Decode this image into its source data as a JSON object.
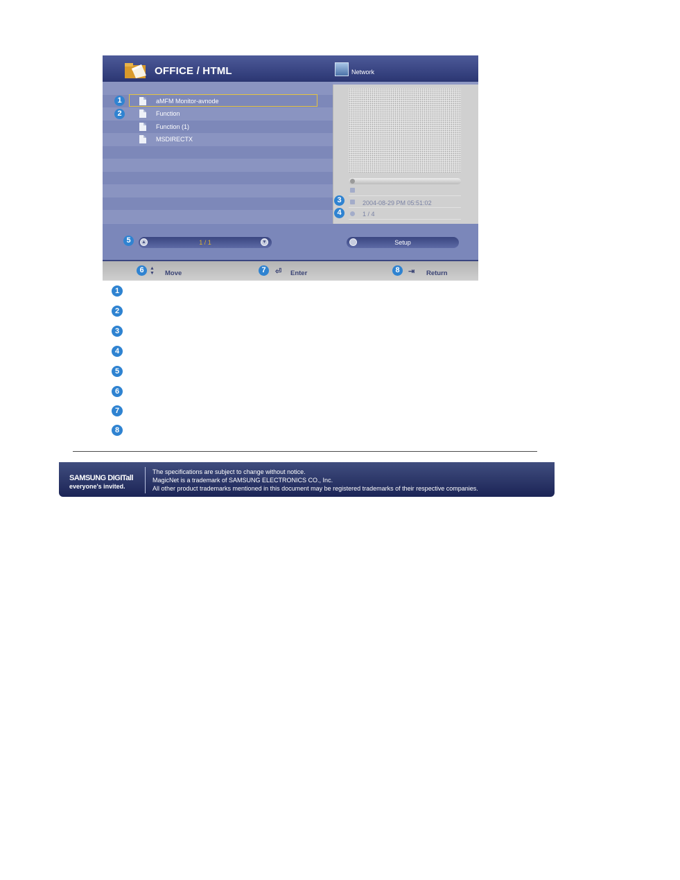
{
  "screen": {
    "title": "OFFICE / HTML",
    "network_label": "Network",
    "files": [
      {
        "name": "aMFM Monitor-avnode",
        "selected": true
      },
      {
        "name": "Function",
        "selected": false
      },
      {
        "name": "Function (1)",
        "selected": false
      },
      {
        "name": "MSDIRECTX",
        "selected": false
      }
    ],
    "preview": {
      "date": "2004-08-29 PM 05:51:02",
      "pages": "1 / 4"
    },
    "pager": "1 / 1",
    "setup_label": "Setup",
    "footer": {
      "move": "Move",
      "enter": "Enter",
      "return": "Return"
    },
    "callouts": [
      "1",
      "2",
      "3",
      "4",
      "5",
      "6",
      "7",
      "8"
    ]
  },
  "legend": [
    "1",
    "2",
    "3",
    "4",
    "5",
    "6",
    "7",
    "8"
  ],
  "banner": {
    "logo_main": "SAMSUNG DIGITall",
    "logo_sub": "everyone's invited.",
    "lines": [
      "The specifications are subject to change without notice.",
      "MagicNet is a trademark of SAMSUNG ELECTRONICS CO., Inc.",
      "All other product trademarks mentioned in this document may be registered trademarks of their respective companies."
    ]
  },
  "colors": {
    "header": "#2b3672",
    "accent_badge": "#2f83d1",
    "selection_frame": "#e5c33f",
    "pager_text": "#e0b531"
  },
  "icons": [
    "folder-icon",
    "network-icon",
    "document-icon",
    "up-down-arrow-icon",
    "enter-icon",
    "return-icon"
  ]
}
